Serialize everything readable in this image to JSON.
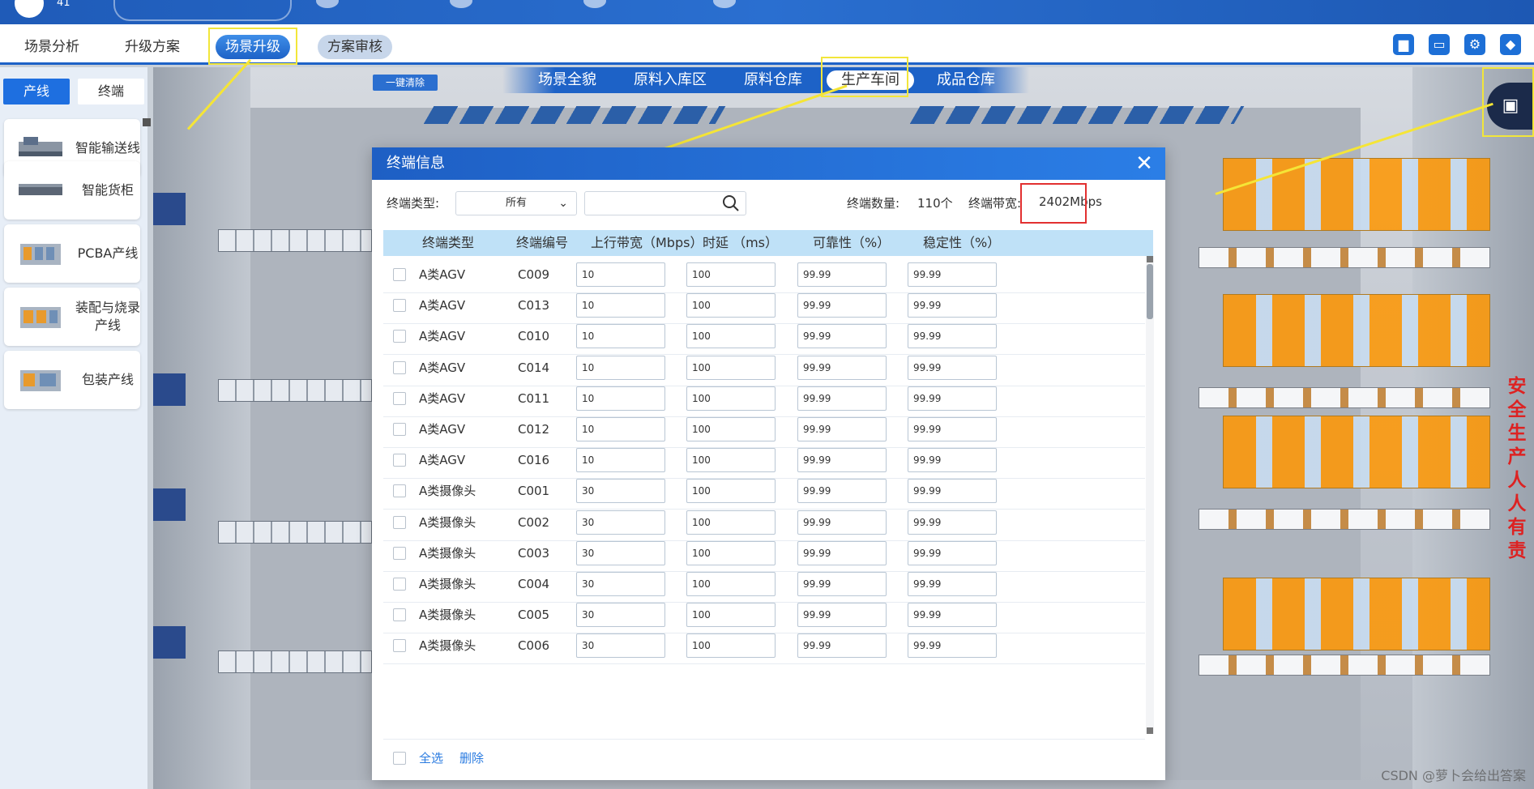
{
  "topbar": {
    "badge_num": "41"
  },
  "nav": {
    "items": [
      "场景分析",
      "升级方案",
      "场景升级",
      "方案审核"
    ],
    "icons": [
      "document-icon",
      "monitor-icon",
      "gear-icon",
      "layers-icon"
    ]
  },
  "left_panel": {
    "tabs": [
      "产线",
      "终端"
    ],
    "cards": [
      "智能输送线",
      "智能货柜",
      "PCBA产线",
      "装配与烧录产线",
      "包装产线"
    ]
  },
  "scene": {
    "clear_button": "一键清除",
    "tabs": [
      "场景全貌",
      "原料入库区",
      "原料仓库",
      "生产车间",
      "成品仓库"
    ],
    "active_tab": "生产车间",
    "vertical_text": "安全生产 人人有责"
  },
  "modal": {
    "title": "终端信息",
    "filter_label": "终端类型:",
    "filter_value": "所有",
    "count_label": "终端数量:",
    "count_value": "110个",
    "bw_label": "终端带宽:",
    "bw_value": "2402Mbps",
    "columns": [
      "终端类型",
      "终端编号",
      "上行带宽（Mbps）",
      "时延 （ms）",
      "可靠性（%）",
      "稳定性（%）"
    ],
    "rows": [
      {
        "type": "A类AGV",
        "code": "C009",
        "bw": "10",
        "latency": "100",
        "reliability": "99.99",
        "stability": "99.99"
      },
      {
        "type": "A类AGV",
        "code": "C013",
        "bw": "10",
        "latency": "100",
        "reliability": "99.99",
        "stability": "99.99"
      },
      {
        "type": "A类AGV",
        "code": "C010",
        "bw": "10",
        "latency": "100",
        "reliability": "99.99",
        "stability": "99.99"
      },
      {
        "type": "A类AGV",
        "code": "C014",
        "bw": "10",
        "latency": "100",
        "reliability": "99.99",
        "stability": "99.99"
      },
      {
        "type": "A类AGV",
        "code": "C011",
        "bw": "10",
        "latency": "100",
        "reliability": "99.99",
        "stability": "99.99"
      },
      {
        "type": "A类AGV",
        "code": "C012",
        "bw": "10",
        "latency": "100",
        "reliability": "99.99",
        "stability": "99.99"
      },
      {
        "type": "A类AGV",
        "code": "C016",
        "bw": "10",
        "latency": "100",
        "reliability": "99.99",
        "stability": "99.99"
      },
      {
        "type": "A类摄像头",
        "code": "C001",
        "bw": "30",
        "latency": "100",
        "reliability": "99.99",
        "stability": "99.99"
      },
      {
        "type": "A类摄像头",
        "code": "C002",
        "bw": "30",
        "latency": "100",
        "reliability": "99.99",
        "stability": "99.99"
      },
      {
        "type": "A类摄像头",
        "code": "C003",
        "bw": "30",
        "latency": "100",
        "reliability": "99.99",
        "stability": "99.99"
      },
      {
        "type": "A类摄像头",
        "code": "C004",
        "bw": "30",
        "latency": "100",
        "reliability": "99.99",
        "stability": "99.99"
      },
      {
        "type": "A类摄像头",
        "code": "C005",
        "bw": "30",
        "latency": "100",
        "reliability": "99.99",
        "stability": "99.99"
      },
      {
        "type": "A类摄像头",
        "code": "C006",
        "bw": "30",
        "latency": "100",
        "reliability": "99.99",
        "stability": "99.99"
      }
    ],
    "footer": {
      "select_all": "全选",
      "delete": "删除"
    }
  },
  "watermark": "CSDN @萝卜会给出答案",
  "colors": {
    "accent": "#1d62c7",
    "highlight": "#f5e536",
    "alert": "#e23030"
  }
}
